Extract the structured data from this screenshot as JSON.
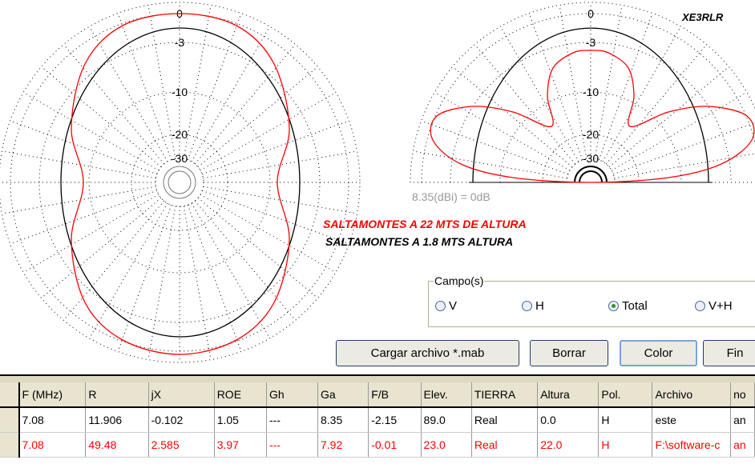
{
  "polar_left": {
    "rings": [
      "0",
      "-3",
      "-10",
      "-20",
      "-30"
    ]
  },
  "polar_right": {
    "rings": [
      "0",
      "-3",
      "-10",
      "-20",
      "-30"
    ],
    "callsign": "XE3RLR"
  },
  "gain_reference": "8.35(dBi) = 0dB",
  "legend": {
    "red": "SALTAMONTES A 22 MTS DE ALTURA",
    "black": "SALTAMONTES A 1.8 MTS ALTURA"
  },
  "colors": {
    "series_red": "#ff0000",
    "series_black": "#000000"
  },
  "fields": {
    "title": "Campo(s)",
    "options": [
      "V",
      "H",
      "Total",
      "V+H"
    ],
    "selected": "Total"
  },
  "buttons": {
    "load": "Cargar archivo *.mab",
    "clear": "Borrar",
    "color": "Color",
    "end": "Fin"
  },
  "table": {
    "headers": [
      "F (MHz)",
      "R",
      "jX",
      "ROE",
      "Gh",
      "Ga",
      "F/B",
      "Elev.",
      "TIERRA",
      "Altura",
      "Pol.",
      "Archivo",
      "no"
    ],
    "rows": [
      [
        "7.08",
        "11.906",
        "-0.102",
        "1.05",
        "---",
        "8.35",
        "-2.15",
        "89.0",
        "Real",
        "0.0",
        "H",
        "este",
        "an"
      ],
      [
        "7.08",
        "49.48",
        "2.585",
        "3.97",
        "---",
        "7.92",
        "-0.01",
        "23.0",
        "Real",
        "22.0",
        "H",
        "F:\\software-c",
        "an"
      ]
    ]
  }
}
